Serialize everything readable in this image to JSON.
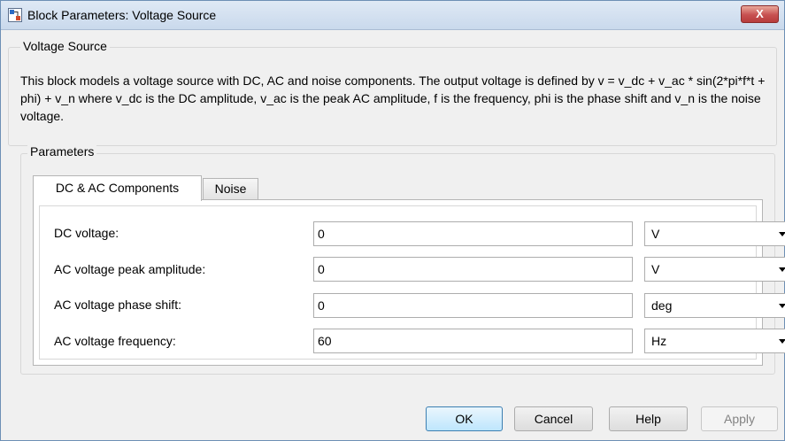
{
  "window": {
    "title": "Block Parameters: Voltage Source",
    "close_label": "X"
  },
  "block_section": {
    "title": "Voltage Source",
    "description": "This block models a voltage source with DC, AC and noise components. The output voltage is defined by v = v_dc + v_ac * sin(2*pi*f*t + phi) + v_n where v_dc is the DC amplitude, v_ac is the peak AC amplitude, f is the frequency, phi is the phase shift and v_n is the noise voltage."
  },
  "parameters": {
    "title": "Parameters",
    "tabs": [
      {
        "label": "DC & AC Components",
        "active": true
      },
      {
        "label": "Noise",
        "active": false
      }
    ],
    "fields": [
      {
        "label": "DC voltage:",
        "value": "0",
        "unit": "V"
      },
      {
        "label": "AC voltage peak amplitude:",
        "value": "0",
        "unit": "V"
      },
      {
        "label": "AC voltage phase shift:",
        "value": "0",
        "unit": "deg"
      },
      {
        "label": "AC voltage frequency:",
        "value": "60",
        "unit": "Hz"
      }
    ]
  },
  "buttons": {
    "ok": "OK",
    "cancel": "Cancel",
    "help": "Help",
    "apply": "Apply"
  },
  "icons": {
    "app": "simulink-block-icon",
    "close": "close-icon",
    "dropdown": "chevron-down-icon"
  },
  "colors": {
    "titlebar": "#c9d9ec",
    "close_button": "#c75050",
    "default_button": "#bee6fd"
  }
}
